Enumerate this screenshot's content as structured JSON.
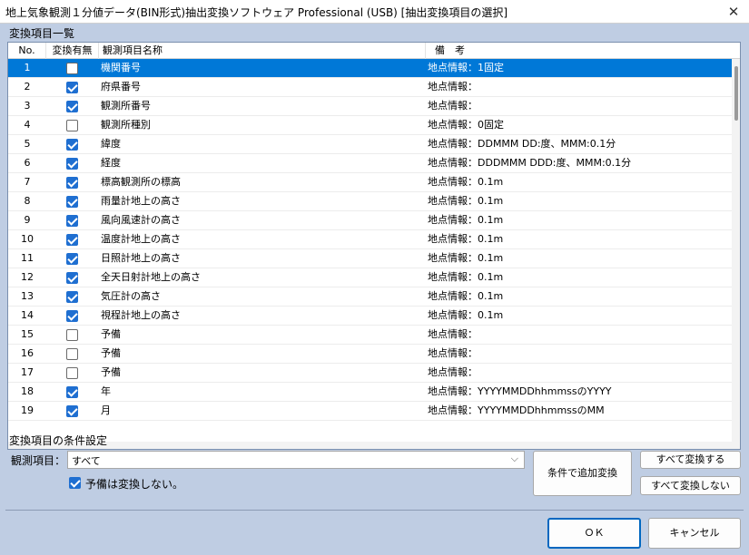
{
  "window": {
    "title": "地上気象観測１分値データ(BIN形式)抽出変換ソフトウェア Professional (USB) [抽出変換項目の選択]",
    "close_glyph": "✕"
  },
  "list_section": {
    "label": "変換項目一覧",
    "columns": [
      "No.",
      "変換有無",
      "観測項目名称",
      "備　考"
    ],
    "rows": [
      {
        "no": "1",
        "checked": false,
        "name": "機関番号",
        "note": "地点情報：1固定",
        "selected": true
      },
      {
        "no": "2",
        "checked": true,
        "name": "府県番号",
        "note": "地点情報：",
        "selected": false
      },
      {
        "no": "3",
        "checked": true,
        "name": "観測所番号",
        "note": "地点情報：",
        "selected": false
      },
      {
        "no": "4",
        "checked": false,
        "name": "観測所種別",
        "note": "地点情報：0固定",
        "selected": false
      },
      {
        "no": "5",
        "checked": true,
        "name": "緯度",
        "note": "地点情報：DDMMM DD:度、MMM:0.1分",
        "selected": false
      },
      {
        "no": "6",
        "checked": true,
        "name": "経度",
        "note": "地点情報：DDDMMM DDD:度、MMM:0.1分",
        "selected": false
      },
      {
        "no": "7",
        "checked": true,
        "name": "標高観測所の標高",
        "note": "地点情報：0.1m",
        "selected": false
      },
      {
        "no": "8",
        "checked": true,
        "name": "雨量計地上の高さ",
        "note": "地点情報：0.1m",
        "selected": false
      },
      {
        "no": "9",
        "checked": true,
        "name": "風向風速計の高さ",
        "note": "地点情報：0.1m",
        "selected": false
      },
      {
        "no": "10",
        "checked": true,
        "name": "温度計地上の高さ",
        "note": "地点情報：0.1m",
        "selected": false
      },
      {
        "no": "11",
        "checked": true,
        "name": "日照計地上の高さ",
        "note": "地点情報：0.1m",
        "selected": false
      },
      {
        "no": "12",
        "checked": true,
        "name": "全天日射計地上の高さ",
        "note": "地点情報：0.1m",
        "selected": false
      },
      {
        "no": "13",
        "checked": true,
        "name": "気圧計の高さ",
        "note": "地点情報：0.1m",
        "selected": false
      },
      {
        "no": "14",
        "checked": true,
        "name": "視程計地上の高さ",
        "note": "地点情報：0.1m",
        "selected": false
      },
      {
        "no": "15",
        "checked": false,
        "name": "予備",
        "note": "地点情報：",
        "selected": false
      },
      {
        "no": "16",
        "checked": false,
        "name": "予備",
        "note": "地点情報：",
        "selected": false
      },
      {
        "no": "17",
        "checked": false,
        "name": "予備",
        "note": "地点情報：",
        "selected": false
      },
      {
        "no": "18",
        "checked": true,
        "name": "年",
        "note": "地点情報：YYYYMMDDhhmmssのYYYY",
        "selected": false
      },
      {
        "no": "19",
        "checked": true,
        "name": "月",
        "note": "地点情報：YYYYMMDDhhmmssのMM",
        "selected": false
      }
    ]
  },
  "conditions": {
    "label": "変換項目の条件設定",
    "field_label": "観測項目：",
    "field_value": "すべて",
    "dropdown_glyph": "⌵",
    "skip_reserved_label": "予備は変換しない。",
    "skip_reserved_checked": true,
    "add_button": "条件で追加変換",
    "convert_all_button": "すべて変換する",
    "convert_none_button": "すべて変換しない"
  },
  "footer": {
    "ok_button": "ＯＫ",
    "cancel_button": "キャンセル"
  },
  "colors": {
    "selection": "#0078d7",
    "checkbox": "#1f6fd1",
    "client_bg": "#bfcde3"
  }
}
